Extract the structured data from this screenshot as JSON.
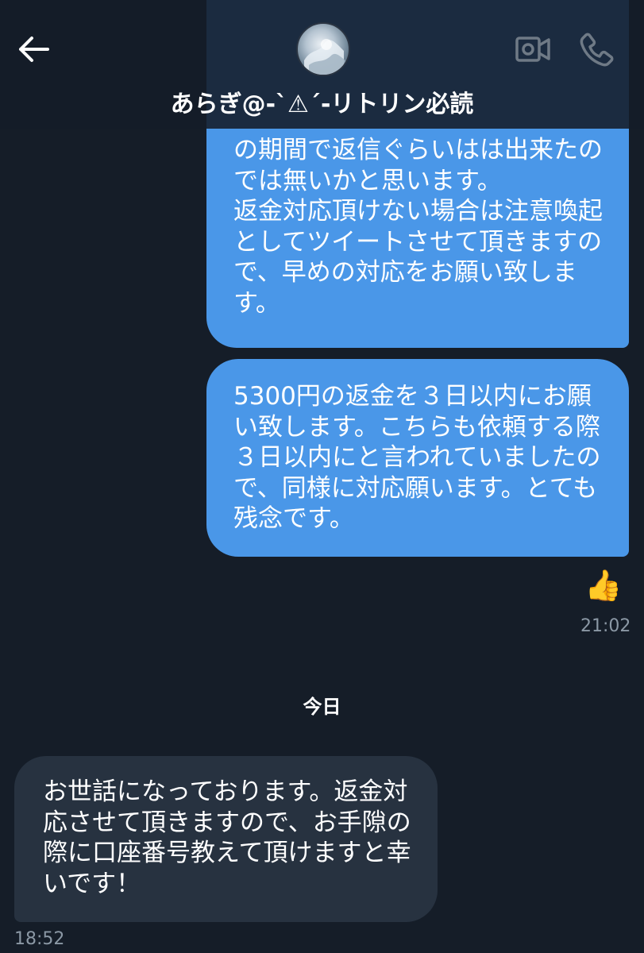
{
  "header": {
    "title": "あらぎ@-ˋ⚠ˊ-リトリン必読",
    "back_icon": "arrow-left-icon",
    "video_icon": "video-camera-icon",
    "call_icon": "phone-icon"
  },
  "messages": [
    {
      "direction": "outgoing",
      "text": "の期間で返信ぐらいはは出来たの\nでは無いかと思います。\n返金対応頂けない場合は注意喚起\nとしてツイートさせて頂きますの\nで、早めの対応をお願い致しま\nす。"
    },
    {
      "direction": "outgoing",
      "text": "5300円の返金を３日以内にお願\nい致します。こちらも依頼する際\n３日以内にと言われていましたの\nで、同様に対応願います。とても\n残念です。",
      "reaction": "👍",
      "time": "21:02"
    },
    {
      "direction": "incoming",
      "text": "お世話になっております。返金対\n応させて頂きますので、お手隙の\n際に口座番号教えて頂けますと幸\nいです！",
      "time": "18:52"
    }
  ],
  "date_separator": "今日",
  "colors": {
    "background": "#151d28",
    "outgoing_bubble": "#4a97e8",
    "incoming_bubble": "#273240",
    "timestamp": "#8b98a5"
  }
}
